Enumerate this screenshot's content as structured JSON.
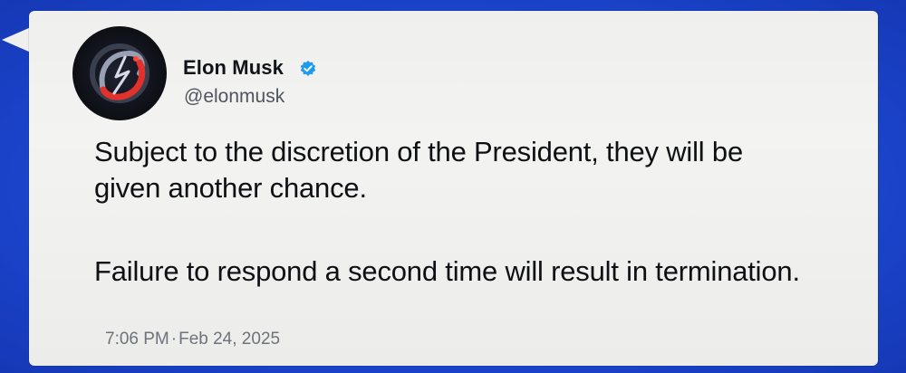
{
  "tweet": {
    "author": {
      "display_name": "Elon Musk",
      "handle": "@elonmusk",
      "verified": true,
      "verified_icon": "verified-badge-icon",
      "avatar_icon": "avatar-icon"
    },
    "paragraphs": [
      "Subject to the discretion of the President, they will be given another chance.",
      "Failure to respond a second time will result in termination."
    ],
    "time": "7:06 PM",
    "date": "Feb 24, 2025",
    "separator": "·"
  },
  "colors": {
    "background": "#1c46cf",
    "card": "#efefed",
    "text": "#0e1014",
    "secondary_text": "#4f5560",
    "verified_badge": "#1d9bf0"
  }
}
